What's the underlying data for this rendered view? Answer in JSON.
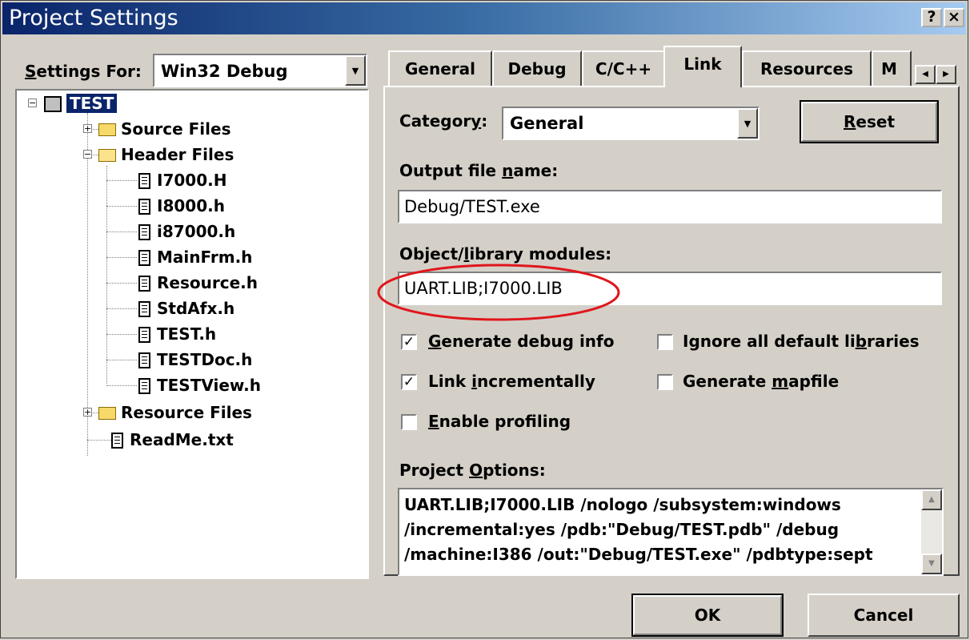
{
  "window": {
    "title": "Project Settings",
    "help_button": "?",
    "close_button": "×"
  },
  "settings_for": {
    "label": "Settings For:",
    "value": "Win32 Debug"
  },
  "tree": {
    "root": "TEST",
    "items": [
      {
        "label": "Source Files",
        "type": "folder"
      },
      {
        "label": "Header Files",
        "type": "folder-open"
      },
      {
        "label": "I7000.H",
        "type": "file"
      },
      {
        "label": "I8000.h",
        "type": "file"
      },
      {
        "label": "i87000.h",
        "type": "file"
      },
      {
        "label": "MainFrm.h",
        "type": "file"
      },
      {
        "label": "Resource.h",
        "type": "file"
      },
      {
        "label": "StdAfx.h",
        "type": "file"
      },
      {
        "label": "TEST.h",
        "type": "file"
      },
      {
        "label": "TESTDoc.h",
        "type": "file"
      },
      {
        "label": "TESTView.h",
        "type": "file"
      },
      {
        "label": "Resource Files",
        "type": "folder"
      },
      {
        "label": "ReadMe.txt",
        "type": "file"
      }
    ]
  },
  "tabs": [
    "General",
    "Debug",
    "C/C++",
    "Link",
    "Resources",
    "M"
  ],
  "active_tab": "Link",
  "link": {
    "category_label": "Category:",
    "category_value": "General",
    "reset_button": "Reset",
    "output_file_label": "Output file name:",
    "output_file_value": "Debug/TEST.exe",
    "object_modules_label": "Object/library modules:",
    "object_modules_value": "UART.LIB;I7000.LIB",
    "checkboxes": {
      "generate_debug_info": {
        "label": "Generate debug info",
        "checked": true
      },
      "ignore_default_libs": {
        "label": "Ignore all default libraries",
        "checked": false
      },
      "link_incrementally": {
        "label": "Link incrementally",
        "checked": true
      },
      "generate_mapfile": {
        "label": "Generate mapfile",
        "checked": false
      },
      "enable_profiling": {
        "label": "Enable profiling",
        "checked": false
      }
    },
    "project_options_label": "Project Options:",
    "project_options_lines": [
      "UART.LIB;I7000.LIB /nologo /subsystem:windows",
      "/incremental:yes /pdb:\"Debug/TEST.pdb\" /debug",
      "/machine:I386 /out:\"Debug/TEST.exe\" /pdbtype:sept"
    ]
  },
  "buttons": {
    "ok": "OK",
    "cancel": "Cancel"
  },
  "colors": {
    "titlebar_start": "#0a246a",
    "highlight_ellipse": "#e0161b",
    "selection": "#0a246a"
  }
}
